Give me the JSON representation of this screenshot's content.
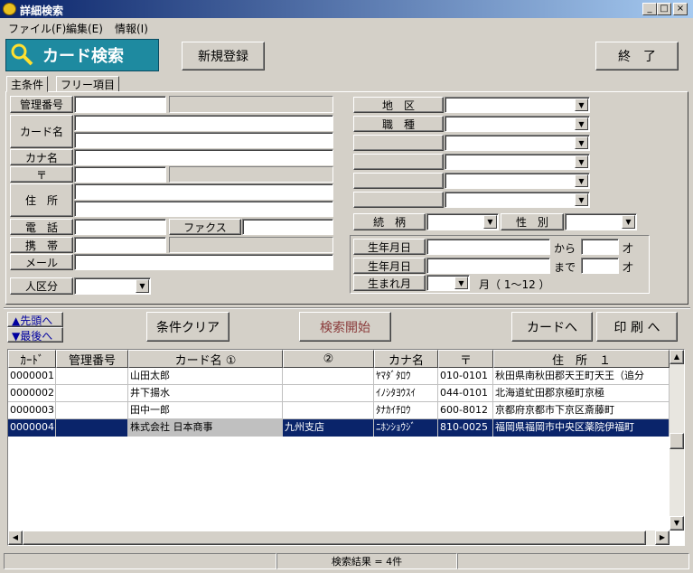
{
  "window": {
    "title": "詳細検索",
    "min": "_",
    "max": "□",
    "close": "×"
  },
  "menu": [
    "ファイル(F)",
    "編集(E)",
    "情報(I)"
  ],
  "toolbar": {
    "logo": "カード検索",
    "new": "新規登録",
    "exit": "終　了"
  },
  "tabs": [
    "主条件",
    "フリー項目"
  ],
  "left_labels": {
    "kanri": "管理番号",
    "card": "カード名",
    "kana": "カナ名",
    "zip": "〒",
    "addr": "住　所",
    "tel": "電　話",
    "fax": "ファクス",
    "mobile": "携　帯",
    "mail": "メール",
    "jin": "人区分"
  },
  "right_labels": {
    "chiku": "地　区",
    "shokushu": "職　種",
    "zokugara": "続　柄",
    "seibetsu": "性　別",
    "birth1": "生年月日",
    "birth2": "生年月日",
    "month": "生まれ月",
    "kara": "から",
    "made": "まで",
    "sai1": "才",
    "sai2": "才",
    "month_range": "月（ 1～12 ）"
  },
  "actions": {
    "first": "▲先頭へ",
    "last": "▼最後へ",
    "clear": "条件クリア",
    "search": "検索開始",
    "tocard": "カードへ",
    "print": "印 刷 へ"
  },
  "grid": {
    "headers": [
      "ｶｰﾄﾞ",
      "管理番号",
      "カード名 ①",
      "②",
      "カナ名",
      "〒",
      "住　所　１"
    ],
    "rows": [
      [
        "0000001",
        "",
        "山田太郎",
        "",
        "ﾔﾏﾀﾞﾀﾛｳ",
        "010-0101",
        "秋田県南秋田郡天王町天王（追分"
      ],
      [
        "0000002",
        "",
        "井下揚水",
        "",
        "ｲﾉｼﾀﾖｳｽｲ",
        "044-0101",
        "北海道虻田郡京極町京極"
      ],
      [
        "0000003",
        "",
        "田中一郎",
        "",
        "ﾀﾅｶｲﾁﾛｳ",
        "600-8012",
        "京都府京都市下京区斎藤町"
      ],
      [
        "0000004",
        "",
        "株式会社 日本商事",
        "九州支店",
        "ﾆﾎﾝｼｮｳｼﾞ",
        "810-0025",
        "福岡県福岡市中央区薬院伊福町"
      ]
    ],
    "selected_row": 3
  },
  "status": "検索結果 = 4件",
  "colors": {
    "title": "#0a246a",
    "logo": "#1e8aa0",
    "search_text": "#8a3a3a",
    "selected": "#0a246a"
  }
}
